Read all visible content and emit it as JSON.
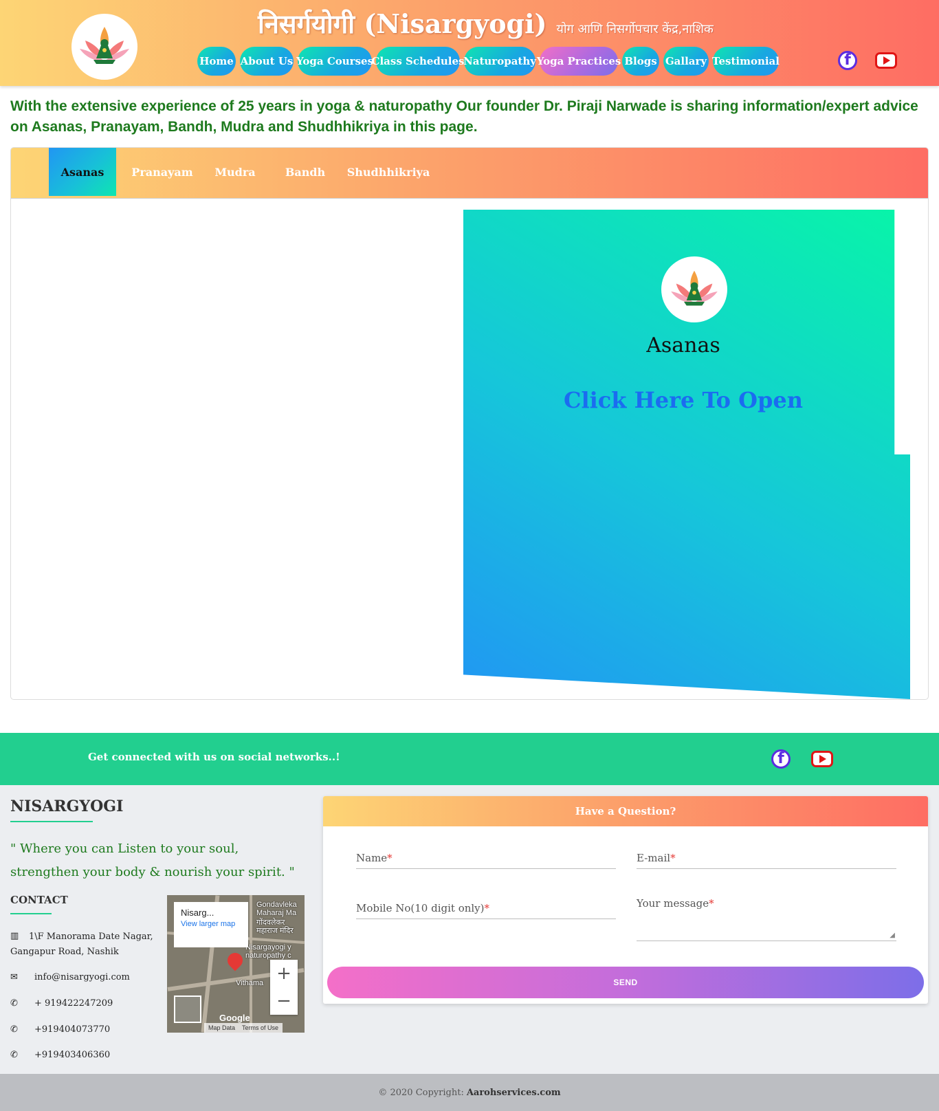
{
  "header": {
    "title": "निसर्गयोगी (Nisargyogi)",
    "subtitle": "योग आणि निसर्गोपचार केंद्र,नाशिक",
    "logo_icon": "lotus-logo-icon"
  },
  "nav": [
    {
      "label": "Home"
    },
    {
      "label": "About Us"
    },
    {
      "label": "Yoga Courses"
    },
    {
      "label": "Class Schedules"
    },
    {
      "label": "Naturopathy"
    },
    {
      "label": "Yoga Practices",
      "active": true
    },
    {
      "label": "Blogs"
    },
    {
      "label": "Gallary"
    },
    {
      "label": "Testimonial"
    }
  ],
  "social": {
    "facebook_icon": "facebook-icon",
    "youtube_icon": "youtube-icon"
  },
  "intro": "With the extensive experience of 25 years in yoga & naturopathy Our founder Dr. Piraji Narwade is sharing information/expert advice on Asanas, Pranayam, Bandh, Mudra and Shudhhikriya in this page.",
  "tabs": [
    {
      "label": "Asanas",
      "active": true
    },
    {
      "label": "Pranayam"
    },
    {
      "label": "Mudra"
    },
    {
      "label": "Bandh"
    },
    {
      "label": "Shudhhikriya"
    }
  ],
  "panel": {
    "title": "Asanas",
    "link": "Click Here To Open"
  },
  "social_band": {
    "text": "Get connected with us on social networks..!"
  },
  "footer": {
    "brand": "NISARGYOGI",
    "quote": "\" Where you can Listen to your soul, strengthen your body & nourish your spirit. \"",
    "contact_heading": "CONTACT",
    "address_line1": "1\\F Manorama Date Nagar,",
    "address_line2": "Gangapur Road, Nashik",
    "email": "info@nisargyogi.com",
    "phones": [
      "+ 919422247209",
      "+919404073770",
      "+919403406360"
    ]
  },
  "map": {
    "card_title": "Nisarg...",
    "card_link": "View larger map",
    "labels": [
      "Gondavleka",
      "Maharaj Ma",
      "गोंदवलेकर",
      "महाराज मंदिर",
      "Nisargayogi y",
      "naturopathy c",
      "Vithama"
    ],
    "zoom_in": "+",
    "zoom_out": "−",
    "google": "Google",
    "map_data": "Map Data",
    "terms": "Terms of Use"
  },
  "form": {
    "heading": "Have a Question?",
    "name_label": "Name",
    "email_label": "E-mail",
    "mobile_label": "Mobile No(10 digit only)",
    "message_label": "Your message",
    "required_mark": "*",
    "send_label": "SEND"
  },
  "copyright": {
    "prefix": "© 2020 Copyright:",
    "site": "Aarohservices.com"
  },
  "colors": {
    "header_gradient": [
      "#fdd575",
      "#fca36b",
      "#fe6d63"
    ],
    "nav_gradient": [
      "#0ee6b0",
      "#2196f3"
    ],
    "active_gradient": [
      "#f16fc7",
      "#7b6ee8"
    ],
    "intro_text": "#1e7a1e",
    "social_band": "#22cf8f",
    "panel_link": "#1b6cf0"
  }
}
